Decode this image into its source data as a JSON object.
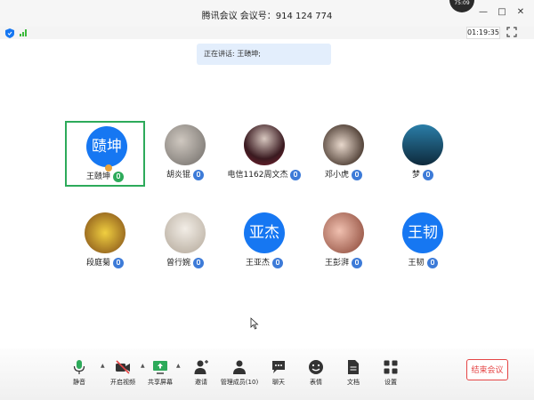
{
  "window": {
    "title": "腾讯会议 会议号：914 124 774",
    "clock_bubble": "75:09",
    "min_glyph": "—",
    "max_glyph": "□",
    "close_glyph": "✕",
    "edge_glyph": "↗"
  },
  "status": {
    "timer": "01:19:35"
  },
  "speaking": {
    "text": "正在讲话: 王赜坤;"
  },
  "participants": [
    {
      "name": "王赜坤",
      "avatar_text": "赜坤",
      "avatar_color": "#1677f2",
      "mic_color": "green",
      "active": true,
      "host": true
    },
    {
      "name": "胡炎锟",
      "avatar_text": "",
      "avatar_color": "#9a9590",
      "mic_color": "blue",
      "active": false
    },
    {
      "name": "电信1162周文杰",
      "avatar_text": "",
      "avatar_color": "#5c2730",
      "mic_color": "blue",
      "active": false
    },
    {
      "name": "邓小虎",
      "avatar_text": "",
      "avatar_color": "#7a6b62",
      "mic_color": "blue",
      "active": false
    },
    {
      "name": "梦",
      "avatar_text": "",
      "avatar_color": "#1b4a68",
      "mic_color": "blue",
      "active": false
    },
    {
      "name": "段庭菊",
      "avatar_text": "",
      "avatar_color": "#c9a33a",
      "mic_color": "blue",
      "active": false
    },
    {
      "name": "曾行婉",
      "avatar_text": "",
      "avatar_color": "#d9d2c6",
      "mic_color": "blue",
      "active": false
    },
    {
      "name": "王亚杰",
      "avatar_text": "亚杰",
      "avatar_color": "#1677f2",
      "mic_color": "blue",
      "active": false
    },
    {
      "name": "王彭湃",
      "avatar_text": "",
      "avatar_color": "#c98f7f",
      "mic_color": "blue",
      "active": false
    },
    {
      "name": "王韧",
      "avatar_text": "王韧",
      "avatar_color": "#1677f2",
      "mic_color": "blue",
      "active": false
    }
  ],
  "toolbar": {
    "mute": "静音",
    "video": "开启视频",
    "share": "共享屏幕",
    "invite": "邀请",
    "manage": "管理成员(10)",
    "chat": "聊天",
    "reactions": "表情",
    "docs": "文档",
    "settings": "设置",
    "end": "结束会议",
    "caret": "▲"
  },
  "colors": {
    "accent": "#1677f2",
    "speaking_border": "#2daa5a",
    "end_red": "#e54545"
  }
}
